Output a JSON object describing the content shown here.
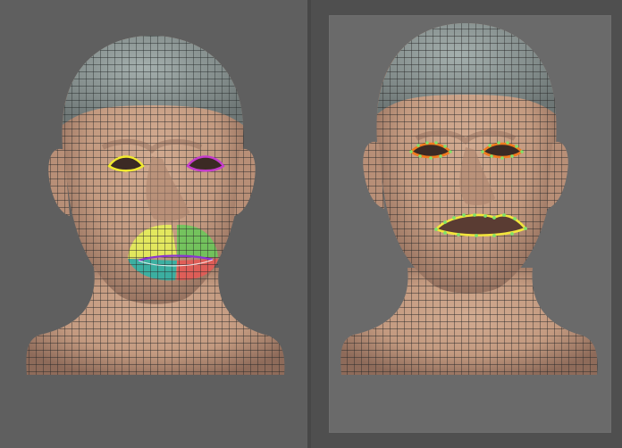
{
  "app": {
    "accent": "#6a6a6a",
    "skin_color": "#c9a187",
    "wire_color": "#2b2b2b",
    "cap_color": "#8f9a98"
  },
  "panes": [
    {
      "id": "left",
      "content": "head-mesh",
      "loop_colors": {
        "right_eye": "#f1ea2e",
        "left_eye": "#c53dcc",
        "mouth_upper_left": "#e6f05a",
        "mouth_upper_right": "#6bc85a",
        "mouth_lower_left": "#2fb2a5",
        "mouth_lower_right": "#e45a55",
        "mouth_center_line": "#8a35d0"
      }
    },
    {
      "id": "right",
      "content": "head-mesh",
      "loop_colors": {
        "eye_loops": "#f07a1e",
        "eye_vertices": "#7fe26b",
        "mouth_loop": "#f2e63d",
        "mouth_vertices": "#7fe26b"
      }
    }
  ]
}
